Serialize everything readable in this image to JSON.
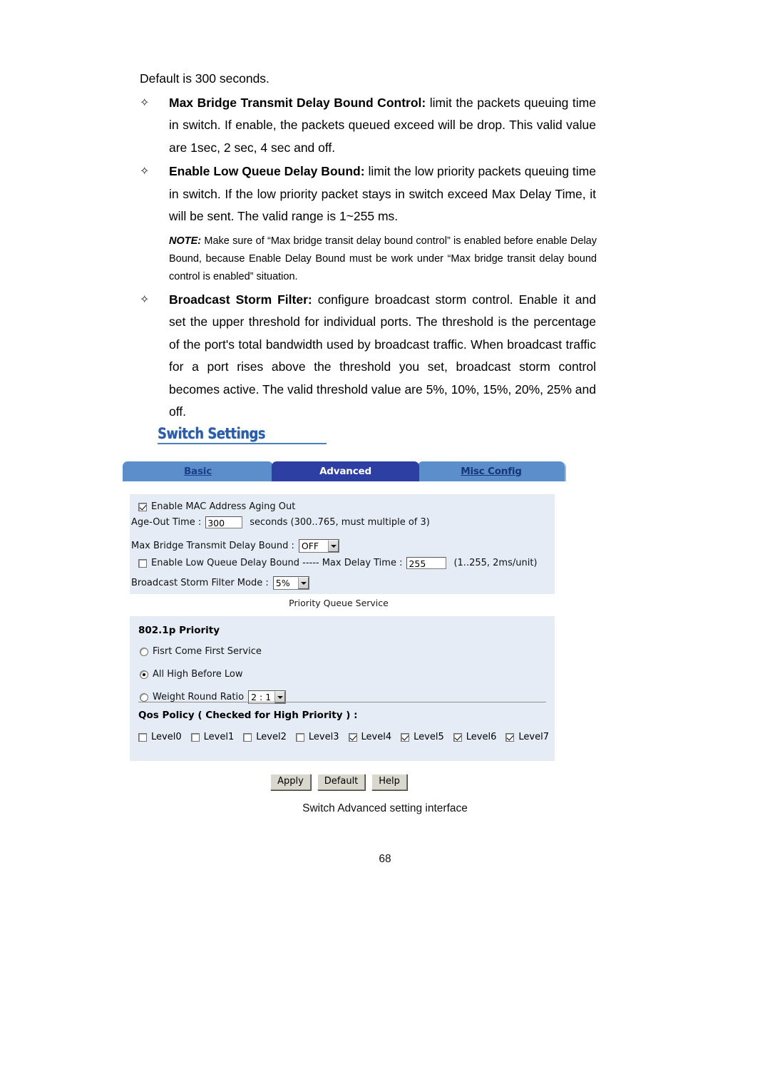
{
  "document": {
    "intro_line": "Default is 300 seconds.",
    "bullets": [
      {
        "marker": "✧",
        "title": "Max Bridge Transmit Delay Bound Control:",
        "body": " limit the packets queuing time in switch. If enable, the packets queued exceed will be drop. This valid value are 1sec, 2 sec, 4 sec and off."
      },
      {
        "marker": "✧",
        "title": "Enable Low Queue Delay Bound:",
        "body": " limit the low priority packets queuing time in switch. If the low priority packet stays in switch exceed Max Delay Time, it will be sent. The valid range is 1~255 ms."
      },
      {
        "marker": "✧",
        "title": "Broadcast Storm Filter:",
        "body": " configure broadcast storm control. Enable it and set the upper threshold for individual ports. The threshold is the percentage of the port's total bandwidth used by broadcast traffic. When broadcast traffic for a port rises above the threshold you set, broadcast storm control becomes active. The valid threshold value are 5%, 10%, 15%, 20%, 25% and off."
      }
    ],
    "note": {
      "label": "NOTE:",
      "text": " Make sure of “Max bridge transit delay bound control” is enabled before enable Delay Bound, because Enable Delay Bound must be work under “Max bridge transit delay bound control is enabled” situation."
    },
    "figure_caption": "Switch Advanced setting interface",
    "page_number": "68"
  },
  "screenshot": {
    "title": "Switch Settings",
    "tabs": [
      {
        "label": "Basic",
        "active": false
      },
      {
        "label": "Advanced",
        "active": true
      },
      {
        "label": "Misc Config",
        "active": false
      }
    ],
    "settings": {
      "mac_aging": {
        "label": "Enable MAC Address Aging Out",
        "checked": true
      },
      "age_out": {
        "label": "Age-Out Time :",
        "value": "300",
        "hint": "seconds (300..765, must multiple of 3)"
      },
      "max_bridge": {
        "label": "Max Bridge Transmit Delay Bound :",
        "value": "OFF"
      },
      "low_queue": {
        "label": "Enable Low Queue Delay Bound ----- Max Delay Time :",
        "checked": false,
        "value": "255",
        "hint": "(1..255, 2ms/unit)"
      },
      "storm_filter": {
        "label": "Broadcast Storm Filter Mode :",
        "value": "5%"
      }
    },
    "priority_queue": {
      "section_label": "Priority Queue Service",
      "heading": "802.1p Priority",
      "options": [
        {
          "label": "Fisrt Come First Service",
          "selected": false
        },
        {
          "label": "All High Before Low",
          "selected": true
        },
        {
          "label": "Weight Round Ratio",
          "selected": false,
          "ratio": "2 : 1"
        }
      ],
      "qos_heading": "Qos Policy ( Checked for High Priority ) :",
      "levels": [
        {
          "label": "Level0",
          "checked": false
        },
        {
          "label": "Level1",
          "checked": false
        },
        {
          "label": "Level2",
          "checked": false
        },
        {
          "label": "Level3",
          "checked": false
        },
        {
          "label": "Level4",
          "checked": true
        },
        {
          "label": "Level5",
          "checked": true
        },
        {
          "label": "Level6",
          "checked": true
        },
        {
          "label": "Level7",
          "checked": true
        }
      ]
    },
    "buttons": [
      {
        "label": "Apply"
      },
      {
        "label": "Default"
      },
      {
        "label": "Help"
      }
    ],
    "colors": {
      "tab_active": "#2e3fa4",
      "tab_inactive": "#5b8ecb",
      "panel_bg": "#e5ecf5",
      "title_blue": "#2b5fae"
    }
  }
}
